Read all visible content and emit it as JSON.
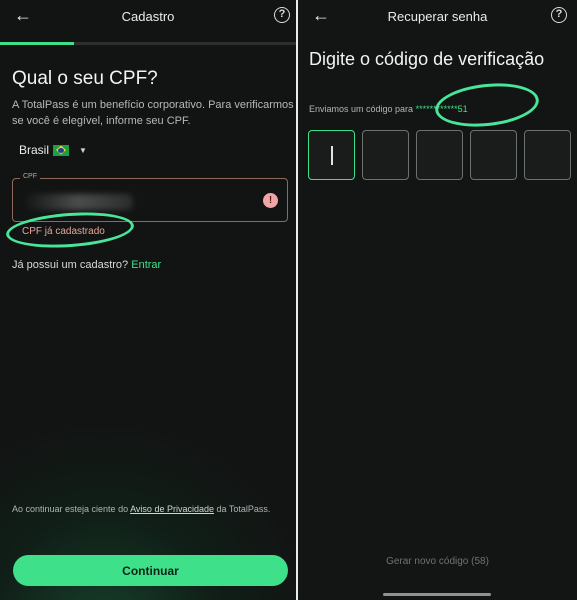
{
  "left": {
    "header": {
      "back_icon": "arrow-left-icon",
      "title": "Cadastro",
      "help_icon": "help-circle-icon",
      "help_glyph": "?"
    },
    "progress": {
      "fraction": 0.25
    },
    "heading": "Qual o seu CPF?",
    "description": "A TotalPass é um benefício corporativo. Para verificarmos se você é elegível, informe seu CPF.",
    "country": {
      "name": "Brasil",
      "flag_icon": "brazil-flag-icon",
      "caret_glyph": "▼"
    },
    "cpf_field": {
      "label": "CPF",
      "value_hidden": true,
      "error_icon": "alert-circle-icon",
      "error_glyph": "!"
    },
    "error_message": "CPF já cadastrado",
    "login": {
      "prompt": "Já possui um cadastro?",
      "link": "Entrar"
    },
    "privacy": {
      "before": "Ao continuar esteja ciente do ",
      "link": "Aviso de Privacidade",
      "after": " da TotalPass."
    },
    "continue_button": "Continuar"
  },
  "right": {
    "header": {
      "back_icon": "arrow-left-icon",
      "title": "Recuperar senha",
      "help_icon": "help-circle-icon",
      "help_glyph": "?"
    },
    "heading": "Digite o código de verificação",
    "sent_prefix": "Enviamos um código para ",
    "masked_phone": "************51",
    "code_boxes": 5,
    "regenerate": "Gerar novo código (58)"
  },
  "colors": {
    "accent": "#3ee08a",
    "error": "#e7a79a",
    "annotation": "#49e69a"
  }
}
